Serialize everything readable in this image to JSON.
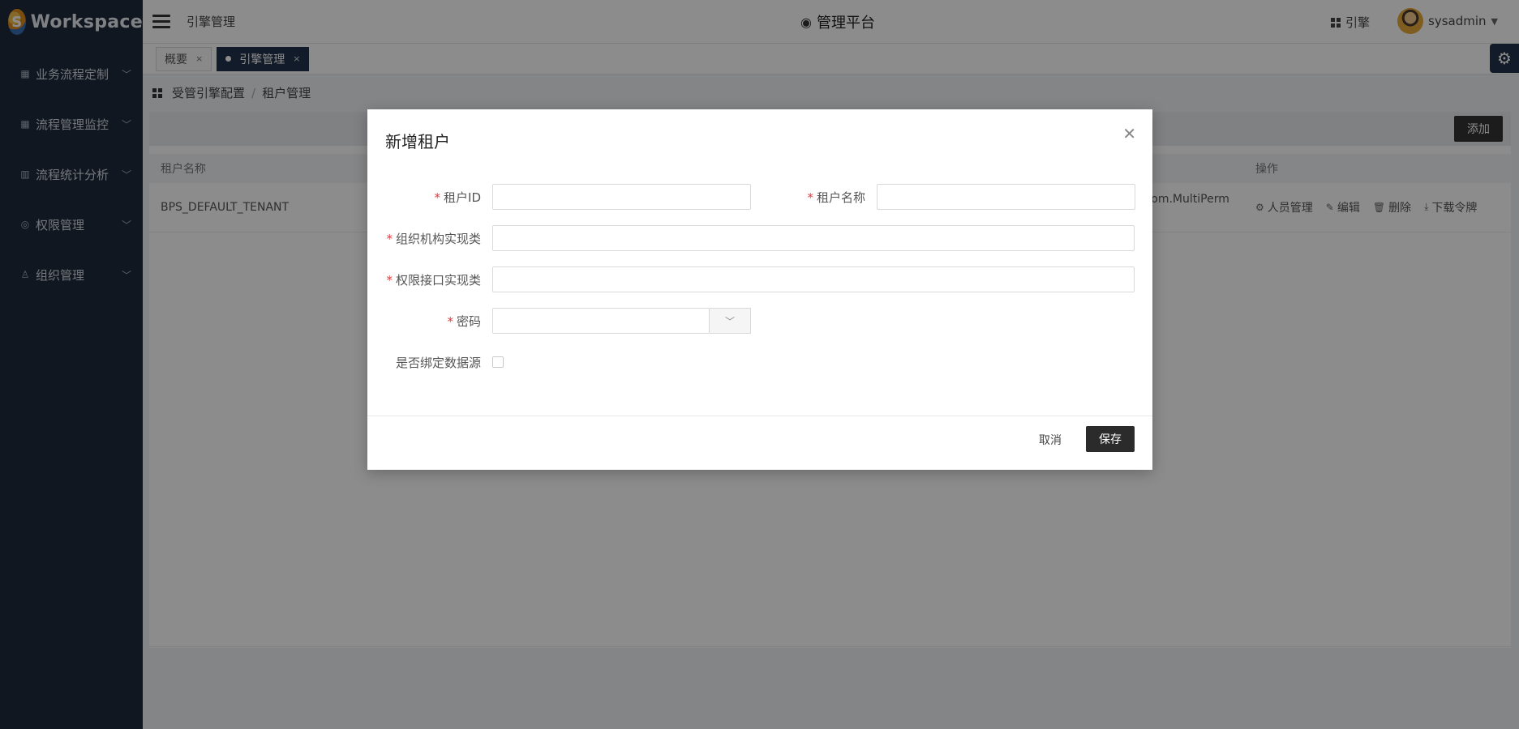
{
  "app": {
    "logo_mark": "S",
    "logo_text": "Workspace"
  },
  "sidebar": {
    "items": [
      {
        "label": "业务流程定制",
        "icon": "flow-icon"
      },
      {
        "label": "流程管理监控",
        "icon": "monitor-icon"
      },
      {
        "label": "流程统计分析",
        "icon": "chart-icon"
      },
      {
        "label": "权限管理",
        "icon": "shield-icon"
      },
      {
        "label": "组织管理",
        "icon": "user-icon"
      }
    ]
  },
  "header": {
    "section_title": "引擎管理",
    "platform_title": "管理平台",
    "engine_link": "引擎",
    "username": "sysadmin"
  },
  "tabs": [
    {
      "label": "概要",
      "active": false
    },
    {
      "label": "引擎管理",
      "active": true
    }
  ],
  "breadcrumb": {
    "parent": "受管引擎配置",
    "current": "租户管理"
  },
  "toolbar": {
    "add_label": "添加"
  },
  "table": {
    "headers": {
      "name": "租户名称",
      "actions": "操作"
    },
    "rows": [
      {
        "name": "BPS_DEFAULT_TENANT",
        "impl": "ltiom.MultiPerm"
      }
    ],
    "actions": [
      "人员管理",
      "编辑",
      "删除",
      "下载令牌"
    ]
  },
  "modal": {
    "title": "新增租户",
    "fields": {
      "tenant_id": {
        "label": "租户ID",
        "value": ""
      },
      "tenant_name": {
        "label": "租户名称",
        "value": ""
      },
      "org_impl": {
        "label": "组织机构实现类",
        "value": ""
      },
      "perm_impl": {
        "label": "权限接口实现类",
        "value": ""
      },
      "password": {
        "label": "密码",
        "value": ""
      },
      "bind_ds": {
        "label": "是否绑定数据源"
      }
    },
    "required_mark": "*",
    "cancel_label": "取消",
    "save_label": "保存"
  }
}
